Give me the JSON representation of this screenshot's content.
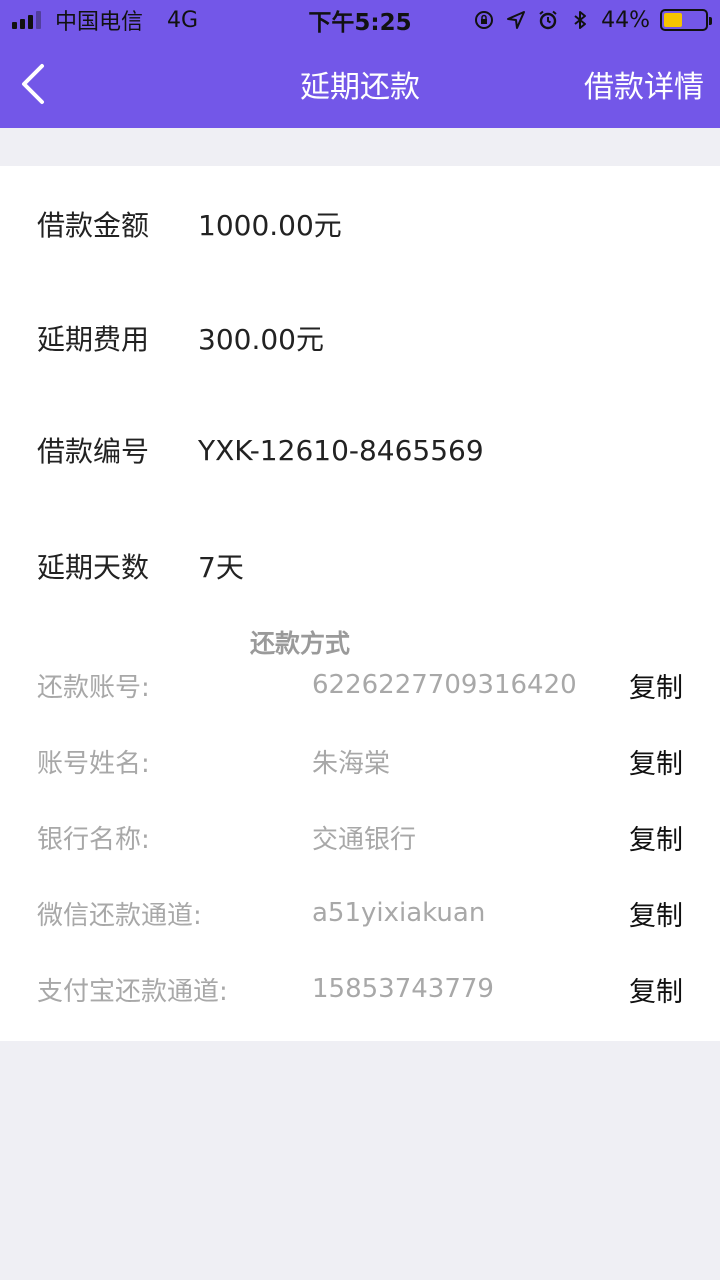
{
  "status_bar": {
    "carrier": "中国电信",
    "network": "4G",
    "time": "下午5:25",
    "battery": "44%"
  },
  "nav": {
    "title": "延期还款",
    "right_action": "借款详情"
  },
  "info": [
    {
      "label": "借款金额",
      "value": "1000.00元"
    },
    {
      "label": "延期费用",
      "value": "300.00元"
    },
    {
      "label": "借款编号",
      "value": "YXK-12610-8465569"
    },
    {
      "label": "延期天数",
      "value": "7天"
    }
  ],
  "payment": {
    "title": "还款方式",
    "copy_label": "复制",
    "rows": [
      {
        "label": "还款账号:",
        "value": "6226227709316420",
        "copy": "复制"
      },
      {
        "label": "账号姓名:",
        "value": "朱海棠",
        "copy": "复制"
      },
      {
        "label": "银行名称:",
        "value": "交通银行",
        "copy": "复制"
      },
      {
        "label": "微信还款通道:",
        "value": "a51yixiakuan",
        "copy": "复制"
      },
      {
        "label": "支付宝还款通道:",
        "value": "15853743779",
        "copy": "复制"
      }
    ]
  },
  "colors": {
    "brand": "#7357e8",
    "page_bg": "#efeff4",
    "muted_text": "#a8a8a8"
  }
}
